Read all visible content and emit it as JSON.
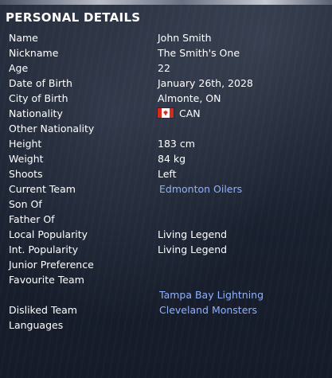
{
  "title": "PERSONAL DETAILS",
  "rows": [
    {
      "label": "Name",
      "value": "John Smith"
    },
    {
      "label": "Nickname",
      "value": "The Smith's One"
    },
    {
      "label": "Age",
      "value": "22"
    },
    {
      "label": "Date of Birth",
      "value": "January 26th, 2028"
    },
    {
      "label": "City of Birth",
      "value": "Almonte, ON"
    },
    {
      "label": "Nationality",
      "value": "CAN",
      "icon": "canada-flag-icon"
    },
    {
      "label": "Other Nationality",
      "value": ""
    },
    {
      "label": "Height",
      "value": "183 cm"
    },
    {
      "label": "Weight",
      "value": "84 kg"
    },
    {
      "label": "Shoots",
      "value": "Left"
    },
    {
      "label": "Current Team",
      "value": "Edmonton Oilers"
    },
    {
      "label": "Son Of",
      "value": ""
    },
    {
      "label": "Father Of",
      "value": ""
    },
    {
      "label": "Local Popularity",
      "value": "Living Legend"
    },
    {
      "label": "Int. Popularity",
      "value": "Living Legend"
    },
    {
      "label": "Junior Preference",
      "value": ""
    },
    {
      "label": "Favourite Team",
      "value": ""
    },
    {
      "label": "",
      "value": "Tampa Bay Lightning"
    },
    {
      "label": "Disliked Team",
      "value": "Cleveland Monsters"
    },
    {
      "label": "Languages",
      "value": ""
    }
  ],
  "colors": {
    "link": "#8fb1ff",
    "text": "#ffffff",
    "background": "#1b2231"
  }
}
